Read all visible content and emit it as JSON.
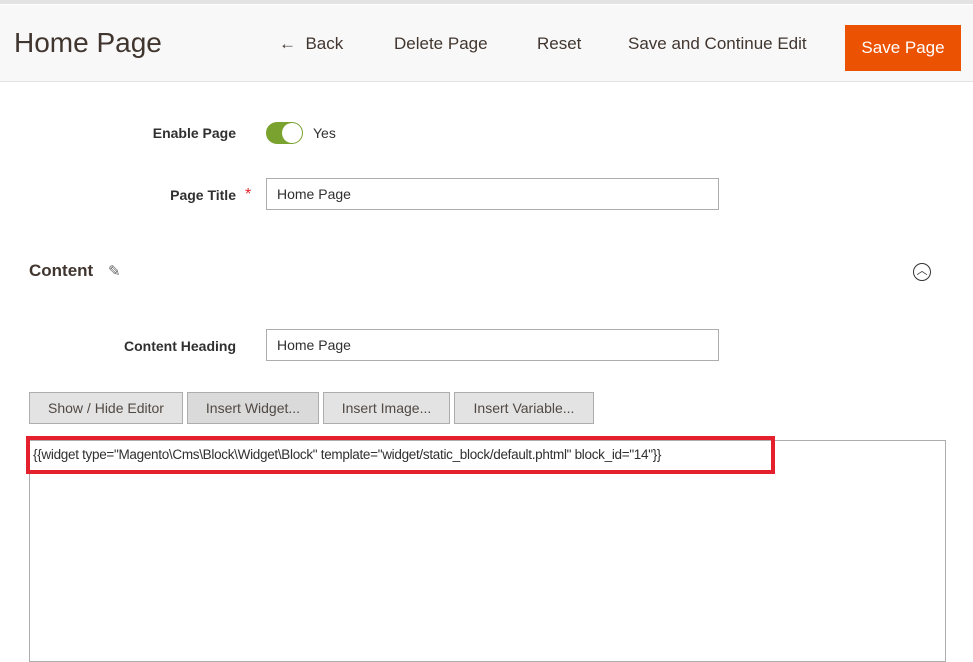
{
  "header": {
    "title": "Home Page",
    "back": "Back",
    "delete": "Delete Page",
    "reset": "Reset",
    "save_continue": "Save and Continue Edit",
    "save": "Save Page"
  },
  "form": {
    "enable_label": "Enable Page",
    "enable_value": "Yes",
    "enabled": true,
    "title_label": "Page Title",
    "title_value": "Home Page",
    "required_mark": "*"
  },
  "content": {
    "section_title": "Content",
    "heading_label": "Content Heading",
    "heading_value": "Home Page",
    "buttons": [
      "Show / Hide Editor",
      "Insert Widget...",
      "Insert Image...",
      "Insert Variable..."
    ],
    "editor_text": "{{widget type=\"Magento\\Cms\\Block\\Widget\\Block\" template=\"widget/static_block/default.phtml\" block_id=\"14\"}}"
  },
  "colors": {
    "accent": "#eb5202",
    "toggle": "#79a22e",
    "highlight": "#e3202b"
  }
}
